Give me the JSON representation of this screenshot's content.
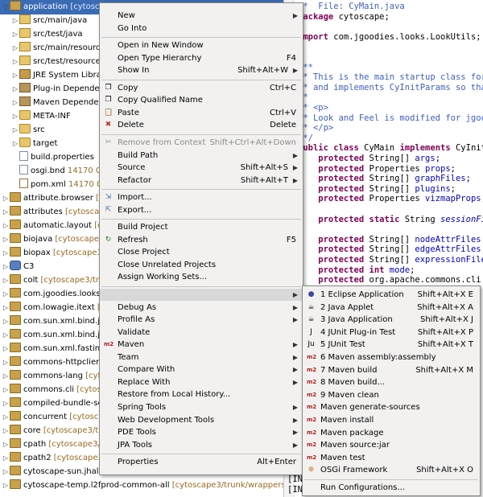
{
  "tree": {
    "rows": [
      {
        "label": "application",
        "decor": "[cytoscape",
        "indent": 0,
        "icon": "project",
        "twisty": "▽",
        "selected": true
      },
      {
        "label": "src/main/java",
        "decor": "",
        "indent": 1,
        "icon": "package-folder",
        "twisty": "▷"
      },
      {
        "label": "src/test/java",
        "decor": "",
        "indent": 1,
        "icon": "package-folder",
        "twisty": "▷"
      },
      {
        "label": "src/main/resources",
        "decor": "",
        "indent": 1,
        "icon": "package-folder",
        "twisty": "▷"
      },
      {
        "label": "src/test/resources",
        "decor": "",
        "indent": 1,
        "icon": "package-folder",
        "twisty": "▷"
      },
      {
        "label": "JRE System Library",
        "decor": "",
        "indent": 1,
        "icon": "jre",
        "twisty": "▷"
      },
      {
        "label": "Plug-in Dependencies",
        "decor": "",
        "indent": 1,
        "icon": "library",
        "twisty": "▷"
      },
      {
        "label": "Maven Dependencies",
        "decor": "",
        "indent": 1,
        "icon": "library",
        "twisty": "▷"
      },
      {
        "label": "META-INF",
        "decor": "",
        "indent": 1,
        "icon": "folder",
        "twisty": "▷"
      },
      {
        "label": "src",
        "decor": "",
        "indent": 1,
        "icon": "folder",
        "twisty": "▷"
      },
      {
        "label": "target",
        "decor": "",
        "indent": 1,
        "icon": "folder",
        "twisty": "▷"
      },
      {
        "label": "build.properties",
        "decor": "",
        "indent": 1,
        "icon": "file",
        "twisty": ""
      },
      {
        "label": "osgi.bnd",
        "decor": "14170  08/",
        "indent": 1,
        "icon": "file",
        "twisty": ""
      },
      {
        "label": "pom.xml",
        "decor": "14170  08/",
        "indent": 1,
        "icon": "xml",
        "twisty": ""
      },
      {
        "label": "attribute.browser",
        "decor": "[cyto",
        "indent": 0,
        "icon": "project",
        "twisty": "▷"
      },
      {
        "label": "attributes",
        "decor": "[cytoscape3/",
        "indent": 0,
        "icon": "project",
        "twisty": "▷"
      },
      {
        "label": "automatic.layout",
        "decor": "[cyto",
        "indent": 0,
        "icon": "project",
        "twisty": "▷"
      },
      {
        "label": "biojava",
        "decor": "[cytoscape3/trun",
        "indent": 0,
        "icon": "project",
        "twisty": "▷"
      },
      {
        "label": "biopax",
        "decor": "[cytoscape3/trun",
        "indent": 0,
        "icon": "project",
        "twisty": "▷"
      },
      {
        "label": "C3",
        "decor": "",
        "indent": 0,
        "icon": "c3",
        "twisty": "▷"
      },
      {
        "label": "colt",
        "decor": "[cytoscape3/trunk/",
        "indent": 0,
        "icon": "project",
        "twisty": "▷"
      },
      {
        "label": "com.jgoodies.looks",
        "decor": "[cyto",
        "indent": 0,
        "icon": "project",
        "twisty": "▷"
      },
      {
        "label": "com.lowagie.itext",
        "decor": "[cyto",
        "indent": 0,
        "icon": "project",
        "twisty": "▷"
      },
      {
        "label": "com.sun.xml.bind.jaxb-",
        "decor": "",
        "indent": 0,
        "icon": "project",
        "twisty": "▷"
      },
      {
        "label": "com.sun.xml.bind.jaxb-",
        "decor": "",
        "indent": 0,
        "icon": "project",
        "twisty": "▷"
      },
      {
        "label": "com.sun.xml.fastinfose",
        "decor": "",
        "indent": 0,
        "icon": "project",
        "twisty": "▷"
      },
      {
        "label": "commons-httpclient",
        "decor": "[cy",
        "indent": 0,
        "icon": "project",
        "twisty": "▷"
      },
      {
        "label": "commons-lang",
        "decor": "[cytosca",
        "indent": 0,
        "icon": "project",
        "twisty": "▷"
      },
      {
        "label": "commons.cli",
        "decor": "[cytoscap",
        "indent": 0,
        "icon": "project",
        "twisty": "▷"
      },
      {
        "label": "compiled-bundle-setting",
        "decor": "",
        "indent": 0,
        "icon": "project",
        "twisty": "▷"
      },
      {
        "label": "concurrent",
        "decor": "[cytoscape3",
        "indent": 0,
        "icon": "project",
        "twisty": "▷"
      },
      {
        "label": "core",
        "decor": "[cytoscape3/trunk",
        "indent": 0,
        "icon": "project",
        "twisty": "▷"
      },
      {
        "label": "cpath",
        "decor": "[cytoscape3/trunk",
        "indent": 0,
        "icon": "project",
        "twisty": "▷"
      },
      {
        "label": "cpath2",
        "decor": "[cytoscape3/trun",
        "indent": 0,
        "icon": "project",
        "twisty": "▷"
      },
      {
        "label": "cytoscape-sun.jhall",
        "decor": "[cytoscape3/trunk/wrappers/cytoscape-sun.jhall]",
        "indent": 0,
        "icon": "project",
        "twisty": "▷"
      },
      {
        "label": "cytoscape-temp.l2fprod-common-all",
        "decor": "[cytoscape3/trunk/wrappers/cytosca",
        "indent": 0,
        "icon": "project",
        "twisty": "▷"
      }
    ]
  },
  "editor": {
    "lines": [
      {
        "parts": [
          {
            "t": " *  File: CyMain.java",
            "c": "cm"
          }
        ]
      },
      {
        "parts": [
          {
            "t": "package",
            "c": "kw"
          },
          {
            "t": " cytoscape;",
            "c": ""
          }
        ]
      },
      {
        "parts": []
      },
      {
        "parts": [
          {
            "t": "import",
            "c": "kw"
          },
          {
            "t": " com.jgoodies.looks.LookUtils;",
            "c": ""
          }
        ]
      },
      {
        "parts": []
      },
      {
        "parts": []
      },
      {
        "parts": [
          {
            "t": "/**",
            "c": "cm"
          }
        ]
      },
      {
        "parts": [
          {
            "t": " * This is the main startup class for",
            "c": "cm"
          }
        ]
      },
      {
        "parts": [
          {
            "t": " * and implements CyInitParams so tha",
            "c": "cm"
          }
        ]
      },
      {
        "parts": [
          {
            "t": " *",
            "c": "cm"
          }
        ]
      },
      {
        "parts": [
          {
            "t": " * <p>",
            "c": "cm"
          }
        ]
      },
      {
        "parts": [
          {
            "t": " * Look and Feel is modified for jgoo",
            "c": "cm"
          }
        ]
      },
      {
        "parts": [
          {
            "t": " * </p>",
            "c": "cm"
          }
        ]
      },
      {
        "parts": [
          {
            "t": " */",
            "c": "cm"
          }
        ]
      },
      {
        "parts": [
          {
            "t": "public class",
            "c": "kw"
          },
          {
            "t": " CyMain ",
            "c": ""
          },
          {
            "t": "implements",
            "c": "kw"
          },
          {
            "t": " CyInitP",
            "c": ""
          }
        ]
      },
      {
        "parts": [
          {
            "t": "    protected",
            "c": "kw"
          },
          {
            "t": " String[] ",
            "c": ""
          },
          {
            "t": "args",
            "c": "fd"
          },
          {
            "t": ";",
            "c": ""
          }
        ]
      },
      {
        "parts": [
          {
            "t": "    protected",
            "c": "kw"
          },
          {
            "t": " Properties ",
            "c": ""
          },
          {
            "t": "props",
            "c": "fd"
          },
          {
            "t": ";",
            "c": ""
          }
        ]
      },
      {
        "parts": [
          {
            "t": "    protected",
            "c": "kw"
          },
          {
            "t": " String[] ",
            "c": ""
          },
          {
            "t": "graphFiles",
            "c": "fd"
          },
          {
            "t": ";",
            "c": ""
          }
        ]
      },
      {
        "parts": [
          {
            "t": "    protected",
            "c": "kw"
          },
          {
            "t": " String[] ",
            "c": ""
          },
          {
            "t": "plugins",
            "c": "fd"
          },
          {
            "t": ";",
            "c": ""
          }
        ]
      },
      {
        "parts": [
          {
            "t": "    protected",
            "c": "kw"
          },
          {
            "t": " Properties ",
            "c": ""
          },
          {
            "t": "vizmapProps",
            "c": "fd"
          },
          {
            "t": ";",
            "c": ""
          }
        ]
      },
      {
        "parts": []
      },
      {
        "parts": [
          {
            "t": "    protected static",
            "c": "kw"
          },
          {
            "t": " String ",
            "c": ""
          },
          {
            "t": "sessionFil",
            "c": "fd it"
          }
        ]
      },
      {
        "parts": []
      },
      {
        "parts": [
          {
            "t": "    protected",
            "c": "kw"
          },
          {
            "t": " String[] ",
            "c": ""
          },
          {
            "t": "nodeAttrFiles",
            "c": "fd"
          },
          {
            "t": ";",
            "c": ""
          }
        ]
      },
      {
        "parts": [
          {
            "t": "    protected",
            "c": "kw"
          },
          {
            "t": " String[] ",
            "c": ""
          },
          {
            "t": "edgeAttrFiles",
            "c": "fd"
          },
          {
            "t": ";",
            "c": ""
          }
        ]
      },
      {
        "parts": [
          {
            "t": "    protected",
            "c": "kw"
          },
          {
            "t": " String[] ",
            "c": ""
          },
          {
            "t": "expressionFiles",
            "c": "fd"
          }
        ]
      },
      {
        "parts": [
          {
            "t": "    protected int",
            "c": "kw"
          },
          {
            "t": " ",
            "c": ""
          },
          {
            "t": "mode",
            "c": "fd"
          },
          {
            "t": ";",
            "c": ""
          }
        ]
      },
      {
        "parts": [
          {
            "t": "    protected",
            "c": "kw"
          },
          {
            "t": " org.apache.commons.cli.O",
            "c": ""
          }
        ]
      }
    ],
    "console": [
      {
        "t": "[IN"
      },
      {
        "t": "[IN"
      }
    ]
  },
  "context_menu": {
    "items": [
      {
        "type": "item",
        "label": "New",
        "arrow": true
      },
      {
        "type": "item",
        "label": "Go Into"
      },
      {
        "type": "sep"
      },
      {
        "type": "item",
        "label": "Open in New Window"
      },
      {
        "type": "item",
        "label": "Open Type Hierarchy",
        "accel": "F4"
      },
      {
        "type": "item",
        "label": "Show In",
        "accel": "Shift+Alt+W",
        "arrow": true
      },
      {
        "type": "sep"
      },
      {
        "type": "item",
        "label": "Copy",
        "accel": "Ctrl+C",
        "icon": "copy-icon"
      },
      {
        "type": "item",
        "label": "Copy Qualified Name",
        "icon": "copy-qualified-icon"
      },
      {
        "type": "item",
        "label": "Paste",
        "accel": "Ctrl+V",
        "icon": "paste-icon"
      },
      {
        "type": "item",
        "label": "Delete",
        "accel": "Delete",
        "icon": "delete-icon"
      },
      {
        "type": "sep"
      },
      {
        "type": "item",
        "label": "Remove from Context",
        "accel": "Shift+Ctrl+Alt+Down",
        "disabled": true,
        "icon": "remove-context-icon"
      },
      {
        "type": "item",
        "label": "Build Path",
        "arrow": true
      },
      {
        "type": "item",
        "label": "Source",
        "accel": "Shift+Alt+S",
        "arrow": true
      },
      {
        "type": "item",
        "label": "Refactor",
        "accel": "Shift+Alt+T",
        "arrow": true
      },
      {
        "type": "sep"
      },
      {
        "type": "item",
        "label": "Import...",
        "icon": "import-icon"
      },
      {
        "type": "item",
        "label": "Export...",
        "icon": "export-icon"
      },
      {
        "type": "sep"
      },
      {
        "type": "item",
        "label": "Build Project"
      },
      {
        "type": "item",
        "label": "Refresh",
        "accel": "F5",
        "icon": "refresh-icon"
      },
      {
        "type": "item",
        "label": "Close Project"
      },
      {
        "type": "item",
        "label": "Close Unrelated Projects"
      },
      {
        "type": "item",
        "label": "Assign Working Sets..."
      },
      {
        "type": "sep"
      },
      {
        "type": "item",
        "label": "",
        "highlighted": true,
        "arrow": true
      },
      {
        "type": "item",
        "label": "Debug As",
        "arrow": true
      },
      {
        "type": "item",
        "label": "Profile As",
        "arrow": true
      },
      {
        "type": "item",
        "label": "Validate"
      },
      {
        "type": "item",
        "label": "Maven",
        "arrow": true,
        "icon": "maven-icon"
      },
      {
        "type": "item",
        "label": "Team",
        "arrow": true
      },
      {
        "type": "item",
        "label": "Compare With",
        "arrow": true
      },
      {
        "type": "item",
        "label": "Replace With",
        "arrow": true
      },
      {
        "type": "item",
        "label": "Restore from Local History..."
      },
      {
        "type": "item",
        "label": "Spring Tools",
        "arrow": true
      },
      {
        "type": "item",
        "label": "Web Development Tools",
        "arrow": true
      },
      {
        "type": "item",
        "label": "PDE Tools",
        "arrow": true
      },
      {
        "type": "item",
        "label": "JPA Tools",
        "arrow": true
      },
      {
        "type": "sep"
      },
      {
        "type": "item",
        "label": "Properties",
        "accel": "Alt+Enter"
      }
    ]
  },
  "run_as_submenu": {
    "items": [
      {
        "type": "item",
        "label": "1 Eclipse Application",
        "accel": "Shift+Alt+X E",
        "icon": "eclipse-icon"
      },
      {
        "type": "item",
        "label": "2 Java Applet",
        "accel": "Shift+Alt+X A",
        "icon": "applet-icon"
      },
      {
        "type": "item",
        "label": "3 Java Application",
        "accel": "Shift+Alt+X J",
        "icon": "java-app-icon"
      },
      {
        "type": "item",
        "label": "4 JUnit Plug-in Test",
        "accel": "Shift+Alt+X P",
        "icon": "junit-plugin-icon"
      },
      {
        "type": "item",
        "label": "5 JUnit Test",
        "accel": "Shift+Alt+X T",
        "icon": "junit-icon"
      },
      {
        "type": "item",
        "label": "6 Maven assembly:assembly",
        "icon": "maven-icon"
      },
      {
        "type": "item",
        "label": "7 Maven build",
        "accel": "Shift+Alt+X M",
        "icon": "maven-icon"
      },
      {
        "type": "item",
        "label": "8 Maven build...",
        "icon": "maven-icon"
      },
      {
        "type": "item",
        "label": "9 Maven clean",
        "icon": "maven-icon"
      },
      {
        "type": "item",
        "label": "Maven generate-sources",
        "icon": "maven-icon"
      },
      {
        "type": "item",
        "label": "Maven install",
        "icon": "maven-icon"
      },
      {
        "type": "item",
        "label": "Maven package",
        "icon": "maven-icon"
      },
      {
        "type": "item",
        "label": "Maven source:jar",
        "icon": "maven-icon"
      },
      {
        "type": "item",
        "label": "Maven test",
        "icon": "maven-icon"
      },
      {
        "type": "item",
        "label": "OSGi Framework",
        "accel": "Shift+Alt+X O",
        "icon": "osgi-icon"
      },
      {
        "type": "sep"
      },
      {
        "type": "item",
        "label": "Run Configurations..."
      }
    ]
  }
}
